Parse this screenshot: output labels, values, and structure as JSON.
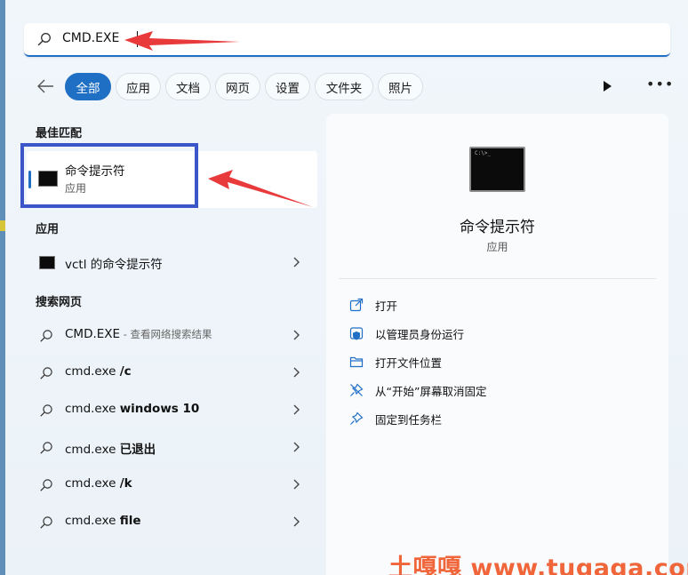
{
  "search": {
    "query": "CMD.EXE"
  },
  "filters": [
    "全部",
    "应用",
    "文档",
    "网页",
    "设置",
    "文件夹",
    "照片"
  ],
  "best_match": {
    "section_title": "最佳匹配",
    "title": "命令提示符",
    "subtitle": "应用"
  },
  "apps": {
    "section_title": "应用",
    "items": [
      {
        "label": "vctl 的命令提示符"
      }
    ]
  },
  "web": {
    "section_title": "搜索网页",
    "items": [
      {
        "prefix": "CMD.EXE",
        "bold": "",
        "hint": " - 查看网络搜索结果"
      },
      {
        "prefix": "cmd.exe ",
        "bold": "/c",
        "hint": ""
      },
      {
        "prefix": "cmd.exe ",
        "bold": "windows 10",
        "hint": ""
      },
      {
        "prefix": "cmd.exe ",
        "bold": "已退出",
        "hint": ""
      },
      {
        "prefix": "cmd.exe ",
        "bold": "/k",
        "hint": ""
      },
      {
        "prefix": "cmd.exe ",
        "bold": "file",
        "hint": ""
      }
    ]
  },
  "detail": {
    "title": "命令提示符",
    "subtitle": "应用",
    "actions": [
      "打开",
      "以管理员身份运行",
      "打开文件位置",
      "从“开始”屏幕取消固定",
      "固定到任务栏"
    ]
  },
  "watermark": "土嘎嘎 www.tugaga.com",
  "colors": {
    "accent": "#1f6fc5",
    "highlight_box": "#3b56c8",
    "arrow": "#e83a3a",
    "watermark": "#f0663a"
  }
}
